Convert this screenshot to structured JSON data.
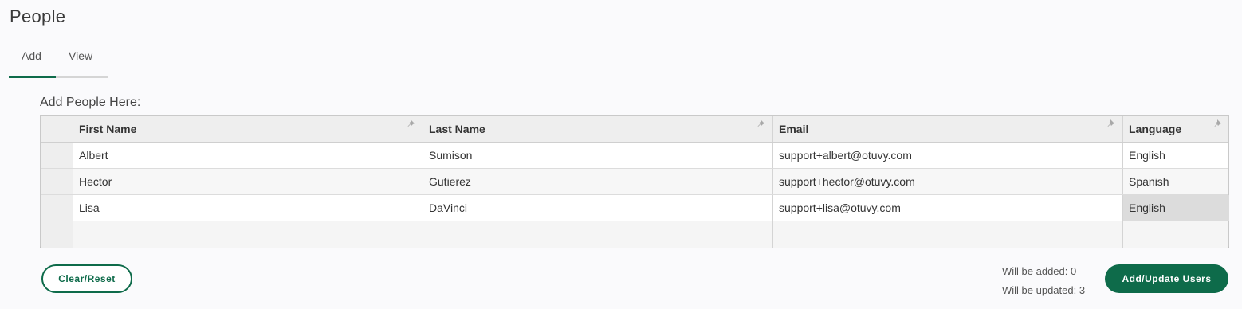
{
  "page_title": "People",
  "tabs": [
    {
      "label": "Add",
      "active": true
    },
    {
      "label": "View",
      "active": false
    }
  ],
  "section_label": "Add People Here:",
  "grid": {
    "columns": [
      "First Name",
      "Last Name",
      "Email",
      "Language"
    ],
    "rows": [
      [
        "Albert",
        "Sumison",
        "support+albert@otuvy.com",
        "English"
      ],
      [
        "Hector",
        "Gutierez",
        "support+hector@otuvy.com",
        "Spanish"
      ],
      [
        "Lisa",
        "DaVinci",
        "support+lisa@otuvy.com",
        "English"
      ],
      [
        "",
        "",
        "",
        ""
      ]
    ],
    "column_icon": "pin-icon"
  },
  "actions": {
    "clear_label": "Clear/Reset",
    "submit_label": "Add/Update Users"
  },
  "stats": {
    "added_text": "Will be added: 0",
    "updated_text": "Will be updated: 3"
  },
  "colors": {
    "accent": "#0e6b4a",
    "header_bg": "#eeeeee",
    "selected_cell_bg": "#dcdcdc"
  }
}
